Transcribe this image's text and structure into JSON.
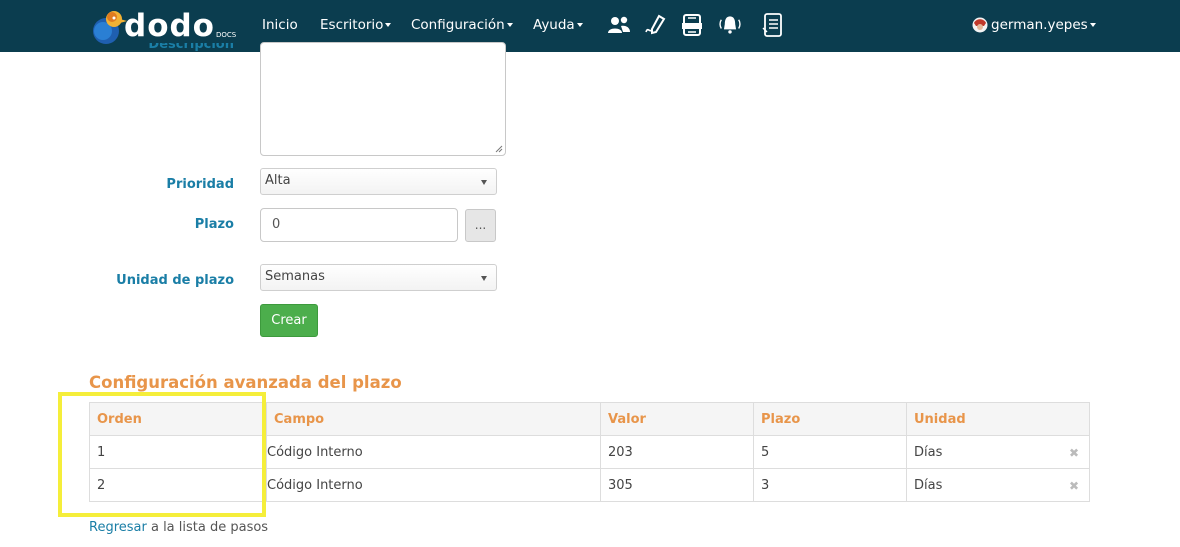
{
  "nav": {
    "logo_text": "dodo",
    "logo_sub": "DOCS",
    "inicio": "Inicio",
    "escritorio": "Escritorio",
    "configuracion": "Configuración",
    "ayuda": "Ayuda",
    "user": "german.yepes"
  },
  "form": {
    "descripcion_label": "Descripción",
    "prioridad_label": "Prioridad",
    "prioridad_value": "Alta",
    "plazo_label": "Plazo",
    "plazo_value": "0",
    "plazo_button": "...",
    "unidad_label": "Unidad de plazo",
    "unidad_value": "Semanas",
    "submit": "Crear"
  },
  "section_title": "Configuración avanzada del plazo",
  "table": {
    "headers": [
      "Orden",
      "Campo",
      "Valor",
      "Plazo",
      "Unidad"
    ],
    "rows": [
      {
        "orden": "1",
        "campo": "Código Interno",
        "valor": "203",
        "plazo": "5",
        "unidad": "Días"
      },
      {
        "orden": "2",
        "campo": "Código Interno",
        "valor": "305",
        "plazo": "3",
        "unidad": "Días"
      }
    ],
    "remove_glyph": "✖"
  },
  "footer": {
    "back_link": "Regresar",
    "back_rest": " a la lista de pasos"
  },
  "colors": {
    "navbar": "#0b3d4f",
    "label": "#1a7ea6",
    "accent_orange": "#e8954a",
    "button_green": "#4cae4c",
    "highlight": "#f5ee3a"
  }
}
